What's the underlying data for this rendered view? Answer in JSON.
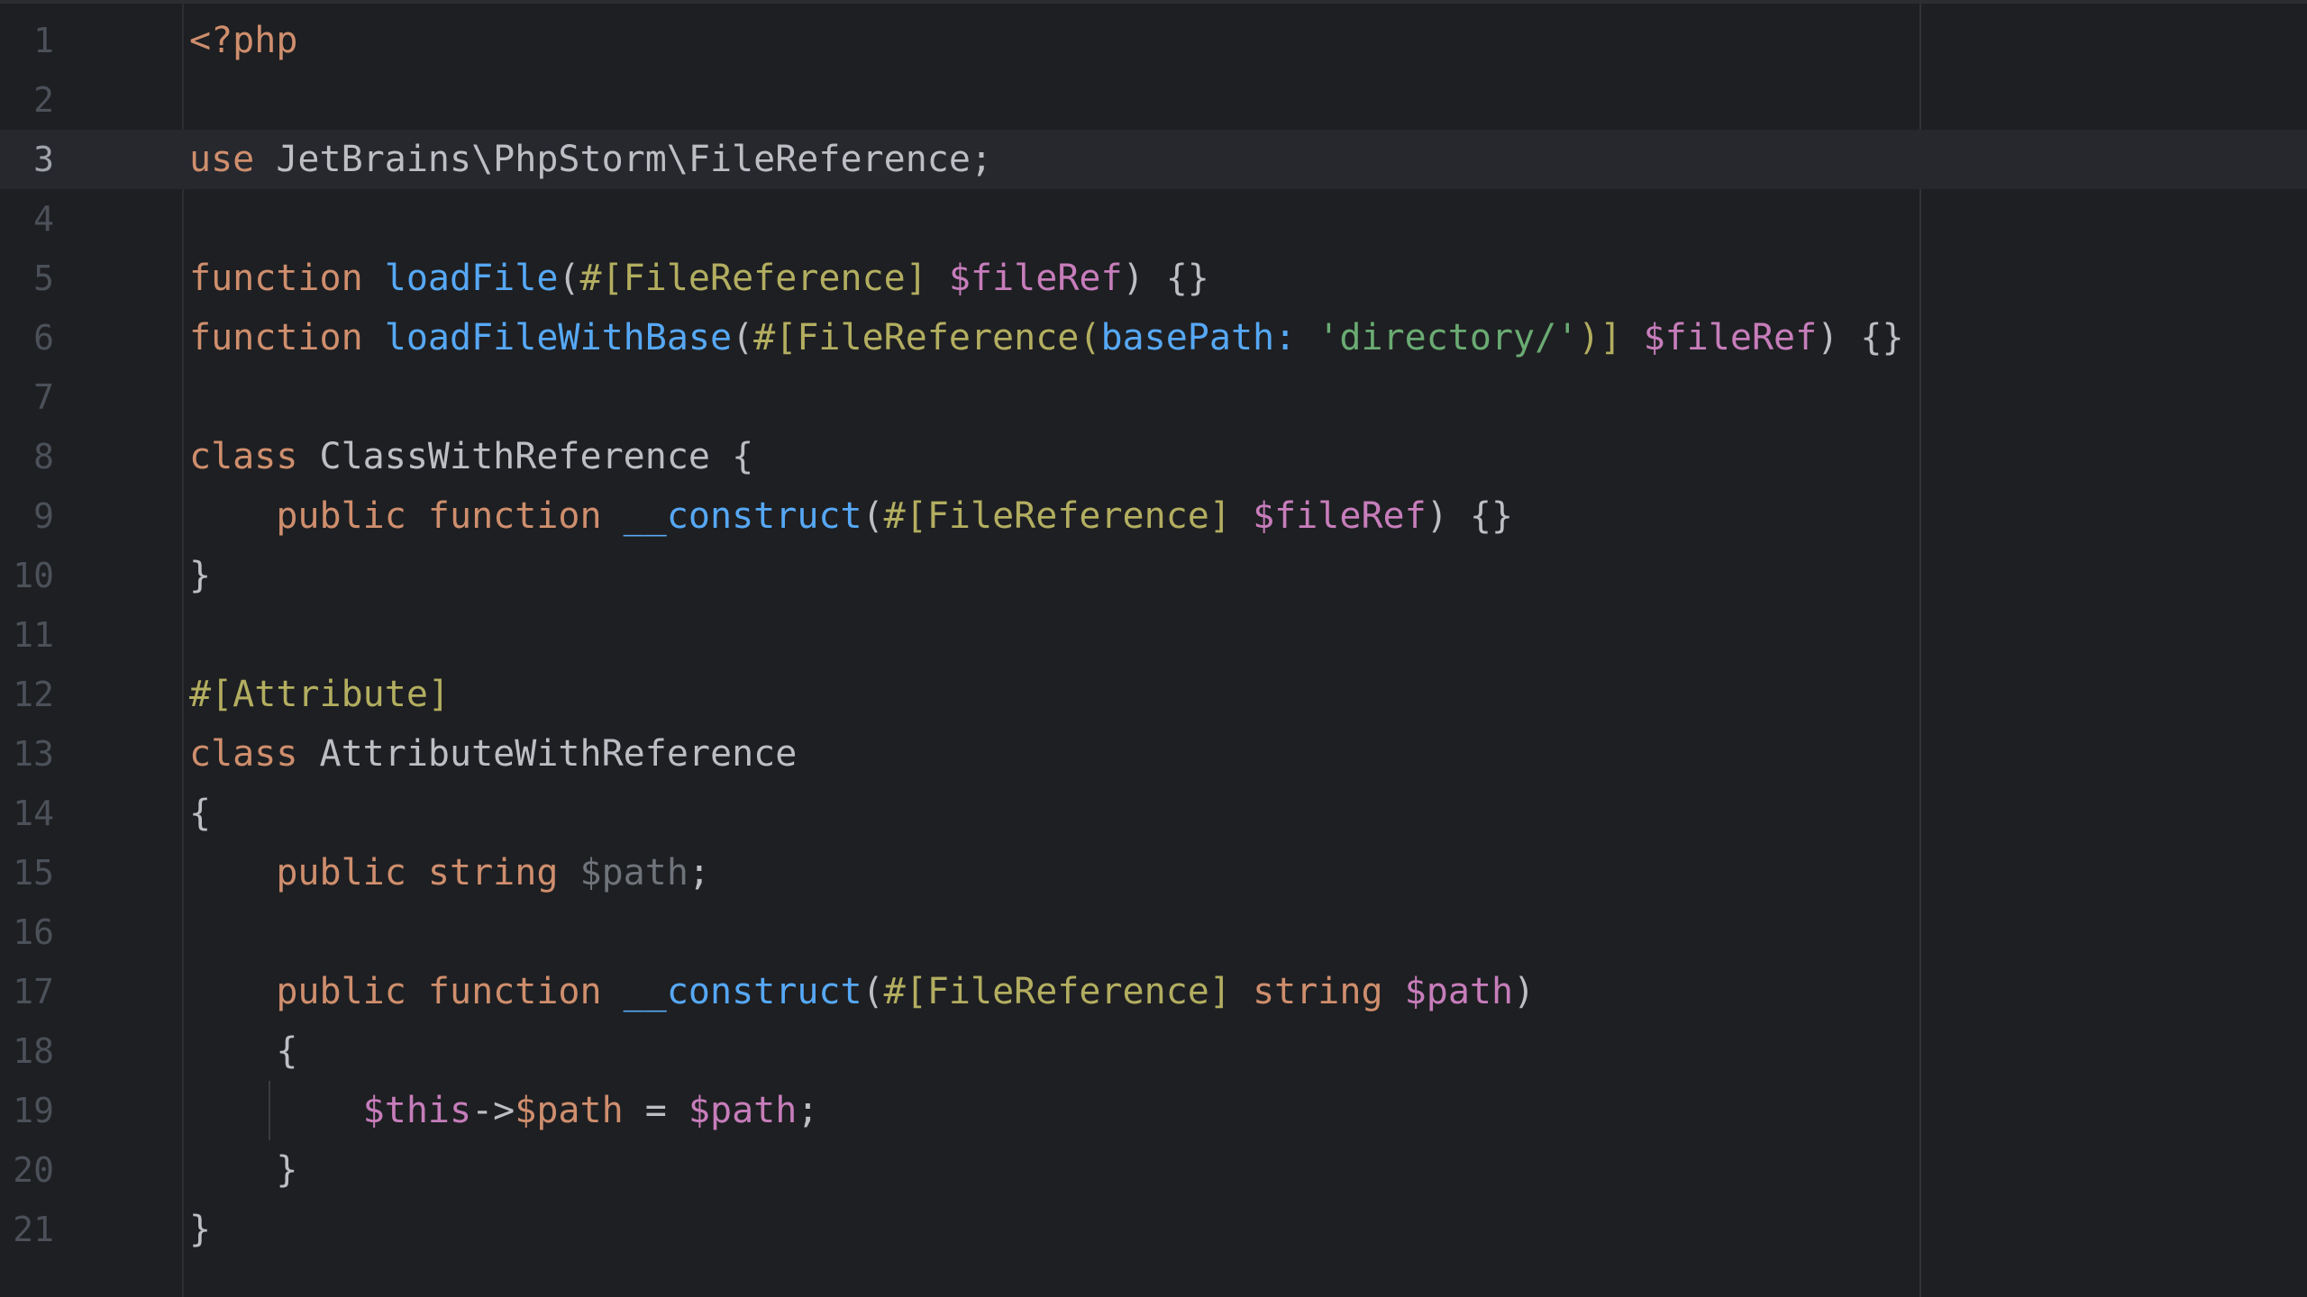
{
  "editor": {
    "language": "PHP",
    "current_line": 3,
    "colors": {
      "background": "#1e1f22",
      "keyword": "#cf8e6d",
      "function": "#56a8f5",
      "attribute": "#b3ae60",
      "variable": "#c77dbb",
      "string": "#6aab73",
      "text": "#bcbec4",
      "line_number": "#4b5059"
    },
    "lines": [
      {
        "n": "1",
        "tokens": [
          {
            "t": "kw",
            "v": "<?php"
          }
        ]
      },
      {
        "n": "2",
        "tokens": []
      },
      {
        "n": "3",
        "tokens": [
          {
            "t": "kw",
            "v": "use"
          },
          {
            "t": "plain",
            "v": " JetBrains\\PhpStorm\\FileReference;"
          }
        ]
      },
      {
        "n": "4",
        "tokens": []
      },
      {
        "n": "5",
        "tokens": [
          {
            "t": "kw",
            "v": "function"
          },
          {
            "t": "plain",
            "v": " "
          },
          {
            "t": "fn",
            "v": "loadFile"
          },
          {
            "t": "plain",
            "v": "("
          },
          {
            "t": "attr",
            "v": "#[FileReference]"
          },
          {
            "t": "plain",
            "v": " "
          },
          {
            "t": "var",
            "v": "$fileRef"
          },
          {
            "t": "plain",
            "v": ") {}"
          }
        ]
      },
      {
        "n": "6",
        "tokens": [
          {
            "t": "kw",
            "v": "function"
          },
          {
            "t": "plain",
            "v": " "
          },
          {
            "t": "fn",
            "v": "loadFileWithBase"
          },
          {
            "t": "plain",
            "v": "("
          },
          {
            "t": "attr",
            "v": "#[FileReference("
          },
          {
            "t": "param",
            "v": "basePath:"
          },
          {
            "t": "plain",
            "v": " "
          },
          {
            "t": "str",
            "v": "'directory/'"
          },
          {
            "t": "attr",
            "v": ")]"
          },
          {
            "t": "plain",
            "v": " "
          },
          {
            "t": "var",
            "v": "$fileRef"
          },
          {
            "t": "plain",
            "v": ") {}"
          }
        ]
      },
      {
        "n": "7",
        "tokens": []
      },
      {
        "n": "8",
        "tokens": [
          {
            "t": "kw",
            "v": "class"
          },
          {
            "t": "plain",
            "v": " ClassWithReference {"
          }
        ]
      },
      {
        "n": "9",
        "tokens": [
          {
            "t": "plain",
            "v": "    "
          },
          {
            "t": "kw",
            "v": "public function"
          },
          {
            "t": "plain",
            "v": " "
          },
          {
            "t": "fn",
            "v": "__construct"
          },
          {
            "t": "plain",
            "v": "("
          },
          {
            "t": "attr",
            "v": "#[FileReference]"
          },
          {
            "t": "plain",
            "v": " "
          },
          {
            "t": "var",
            "v": "$fileRef"
          },
          {
            "t": "plain",
            "v": ") {}"
          }
        ]
      },
      {
        "n": "10",
        "tokens": [
          {
            "t": "plain",
            "v": "}"
          }
        ]
      },
      {
        "n": "11",
        "tokens": []
      },
      {
        "n": "12",
        "tokens": [
          {
            "t": "attr",
            "v": "#[Attribute]"
          }
        ]
      },
      {
        "n": "13",
        "tokens": [
          {
            "t": "kw",
            "v": "class"
          },
          {
            "t": "plain",
            "v": " AttributeWithReference"
          }
        ]
      },
      {
        "n": "14",
        "tokens": [
          {
            "t": "plain",
            "v": "{"
          }
        ]
      },
      {
        "n": "15",
        "tokens": [
          {
            "t": "plain",
            "v": "    "
          },
          {
            "t": "kw",
            "v": "public string"
          },
          {
            "t": "plain",
            "v": " "
          },
          {
            "t": "var-dim",
            "v": "$path"
          },
          {
            "t": "plain",
            "v": ";"
          }
        ]
      },
      {
        "n": "16",
        "tokens": []
      },
      {
        "n": "17",
        "tokens": [
          {
            "t": "plain",
            "v": "    "
          },
          {
            "t": "kw",
            "v": "public function"
          },
          {
            "t": "plain",
            "v": " "
          },
          {
            "t": "fn",
            "v": "__construct"
          },
          {
            "t": "plain",
            "v": "("
          },
          {
            "t": "attr",
            "v": "#[FileReference]"
          },
          {
            "t": "plain",
            "v": " "
          },
          {
            "t": "kw",
            "v": "string"
          },
          {
            "t": "plain",
            "v": " "
          },
          {
            "t": "var",
            "v": "$path"
          },
          {
            "t": "plain",
            "v": ")"
          }
        ]
      },
      {
        "n": "18",
        "tokens": [
          {
            "t": "plain",
            "v": "    {"
          }
        ]
      },
      {
        "n": "19",
        "tokens": [
          {
            "t": "plain",
            "v": "        "
          },
          {
            "t": "var",
            "v": "$this"
          },
          {
            "t": "plain",
            "v": "->"
          },
          {
            "t": "kw",
            "v": "$path"
          },
          {
            "t": "plain",
            "v": " = "
          },
          {
            "t": "var",
            "v": "$path"
          },
          {
            "t": "plain",
            "v": ";"
          }
        ]
      },
      {
        "n": "20",
        "tokens": [
          {
            "t": "plain",
            "v": "    }"
          }
        ]
      },
      {
        "n": "21",
        "tokens": [
          {
            "t": "plain",
            "v": "}"
          }
        ]
      }
    ]
  }
}
